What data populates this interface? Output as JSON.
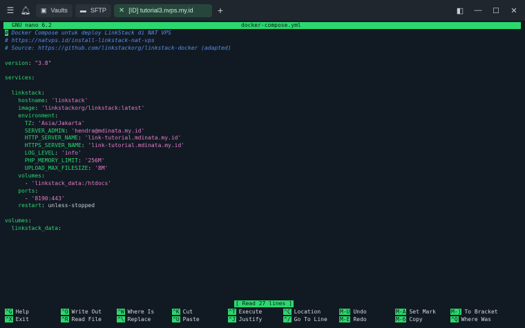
{
  "titlebar": {
    "tabs": [
      {
        "label": "Vaults",
        "icon": "lock-icon"
      },
      {
        "label": "SFTP",
        "icon": "folder-icon"
      },
      {
        "label": "[ID] tutorial3.nvps.my.id",
        "icon": "close-icon"
      }
    ]
  },
  "nano": {
    "version": "GNU nano 6.2",
    "filename": "docker-compose.yml",
    "status": "[ Read 27 lines ]"
  },
  "buffer": {
    "lines": [
      [
        {
          "t": "# Docker Compose untuk deploy LinkStack di NAT VPS",
          "c": "comment"
        }
      ],
      [
        {
          "t": "# https://natvps.id/install-linkstack-nat-vps",
          "c": "comment"
        }
      ],
      [
        {
          "t": "# Source: https://github.com/linkstackorg/linkstack-docker (adapted)",
          "c": "comment"
        }
      ],
      [],
      [
        {
          "t": "version",
          "c": "key"
        },
        {
          "t": ": ",
          "c": "plain"
        },
        {
          "t": "\"3.8\"",
          "c": "str"
        }
      ],
      [],
      [
        {
          "t": "services",
          "c": "key"
        },
        {
          "t": ":",
          "c": "plain"
        }
      ],
      [],
      [
        {
          "t": "  linkstack",
          "c": "key"
        },
        {
          "t": ":",
          "c": "plain"
        }
      ],
      [
        {
          "t": "    hostname",
          "c": "key"
        },
        {
          "t": ": ",
          "c": "plain"
        },
        {
          "t": "'linkstack'",
          "c": "str"
        }
      ],
      [
        {
          "t": "    image",
          "c": "key"
        },
        {
          "t": ": ",
          "c": "plain"
        },
        {
          "t": "'linkstackorg/linkstack:latest'",
          "c": "str"
        }
      ],
      [
        {
          "t": "    environment",
          "c": "key"
        },
        {
          "t": ":",
          "c": "plain"
        }
      ],
      [
        {
          "t": "      TZ",
          "c": "key"
        },
        {
          "t": ": ",
          "c": "plain"
        },
        {
          "t": "'Asia/Jakarta'",
          "c": "str"
        }
      ],
      [
        {
          "t": "      SERVER_ADMIN",
          "c": "key"
        },
        {
          "t": ": ",
          "c": "plain"
        },
        {
          "t": "'hendra@mdinata.my.id'",
          "c": "str"
        }
      ],
      [
        {
          "t": "      HTTP_SERVER_NAME",
          "c": "key"
        },
        {
          "t": ": ",
          "c": "plain"
        },
        {
          "t": "'link-tutorial.mdinata.my.id'",
          "c": "str"
        }
      ],
      [
        {
          "t": "      HTTPS_SERVER_NAME",
          "c": "key"
        },
        {
          "t": ": ",
          "c": "plain"
        },
        {
          "t": "'link-tutorial.mdinata.my.id'",
          "c": "str"
        }
      ],
      [
        {
          "t": "      LOG_LEVEL",
          "c": "key"
        },
        {
          "t": ": ",
          "c": "plain"
        },
        {
          "t": "'info'",
          "c": "str"
        }
      ],
      [
        {
          "t": "      PHP_MEMORY_LIMIT",
          "c": "key"
        },
        {
          "t": ": ",
          "c": "plain"
        },
        {
          "t": "'256M'",
          "c": "str"
        }
      ],
      [
        {
          "t": "      UPLOAD_MAX_FILESIZE",
          "c": "key"
        },
        {
          "t": ": ",
          "c": "plain"
        },
        {
          "t": "'8M'",
          "c": "str"
        }
      ],
      [
        {
          "t": "    volumes",
          "c": "key"
        },
        {
          "t": ":",
          "c": "plain"
        }
      ],
      [
        {
          "t": "      - ",
          "c": "plain"
        },
        {
          "t": "'linkstack_data:/htdocs'",
          "c": "str"
        }
      ],
      [
        {
          "t": "    ports",
          "c": "key"
        },
        {
          "t": ":",
          "c": "plain"
        }
      ],
      [
        {
          "t": "      - ",
          "c": "plain"
        },
        {
          "t": "'8190:443'",
          "c": "str"
        }
      ],
      [
        {
          "t": "    restart",
          "c": "key"
        },
        {
          "t": ": unless-stopped",
          "c": "plain"
        }
      ],
      [],
      [
        {
          "t": "volumes",
          "c": "key"
        },
        {
          "t": ":",
          "c": "plain"
        }
      ],
      [
        {
          "t": "  linkstack_data",
          "c": "key"
        },
        {
          "t": ":",
          "c": "plain"
        }
      ]
    ]
  },
  "shortcuts": {
    "row1": [
      {
        "key": "^G",
        "label": "Help"
      },
      {
        "key": "^O",
        "label": "Write Out"
      },
      {
        "key": "^W",
        "label": "Where Is"
      },
      {
        "key": "^K",
        "label": "Cut"
      },
      {
        "key": "^T",
        "label": "Execute"
      },
      {
        "key": "^C",
        "label": "Location"
      },
      {
        "key": "M-U",
        "label": "Undo"
      },
      {
        "key": "M-A",
        "label": "Set Mark"
      },
      {
        "key": "M-]",
        "label": "To Bracket"
      }
    ],
    "row2": [
      {
        "key": "^X",
        "label": "Exit"
      },
      {
        "key": "^R",
        "label": "Read File"
      },
      {
        "key": "^\\",
        "label": "Replace"
      },
      {
        "key": "^U",
        "label": "Paste"
      },
      {
        "key": "^J",
        "label": "Justify"
      },
      {
        "key": "^/",
        "label": "Go To Line"
      },
      {
        "key": "M-E",
        "label": "Redo"
      },
      {
        "key": "M-6",
        "label": "Copy"
      },
      {
        "key": "^Q",
        "label": "Where Was"
      }
    ]
  },
  "colors": {
    "accent": "#2bd86f",
    "comment": "#5a8de8",
    "string": "#e67cc9"
  }
}
